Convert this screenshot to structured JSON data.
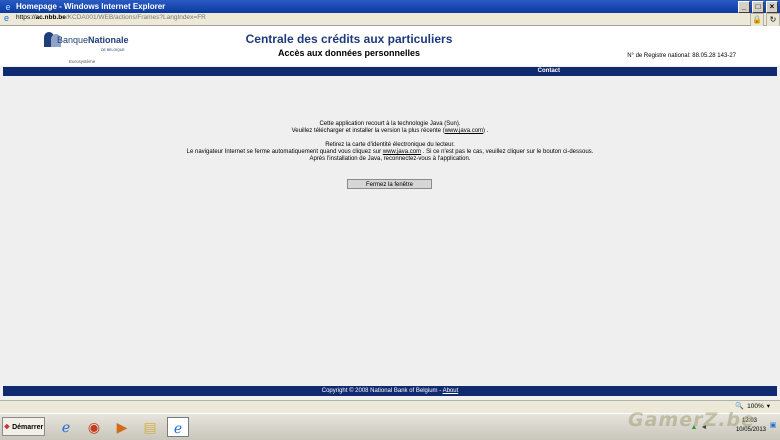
{
  "window": {
    "title": "Homepage - Windows Internet Explorer",
    "buttons": {
      "minimize": "_",
      "maximize": "□",
      "close": "×"
    }
  },
  "address": {
    "scheme": "https://",
    "host": "ac.nbb.be",
    "path": "/KCDA001/WEB/actions/Frames?LangIndex=FR",
    "icons": [
      "ie-page-icon",
      "lock-icon",
      "refresh-icon"
    ]
  },
  "header": {
    "logo_brand_light": "Banque",
    "logo_brand_bold": "Nationale",
    "logo_sub": "DE BELGIQUE",
    "logo_tagline": "Eurosystème",
    "title": "Centrale des crédits aux particuliers",
    "subtitle": "Accès aux données personnelles",
    "registry": "N° de Registre national: 88.05.28 143-27"
  },
  "nav": {
    "contact": "Contact"
  },
  "content": {
    "line1": "Cette application recourt à la technologie Java (Sun).",
    "line2_prefix": "Veuillez télécharger et installer la version la plus récente (",
    "line2_link": "www.java.com",
    "line2_suffix": ") .",
    "line3": "Retirez la carte d'identité électronique du lecteur.",
    "line4_prefix": "Le navigateur Internet se ferme automatiquement quand vous cliquez sur",
    "line4_link": "www.java.com",
    "line4_suffix": ". Si ce n'est pas le cas, veuillez cliquer sur le bouton ci-dessous.",
    "line5": "Après l'installation de Java, reconnectez-vous à l'application.",
    "close_button": "Fermez la fenêtre"
  },
  "footer": {
    "copyright": "Copyright © 2008 National Bank of Belgium  -",
    "about": "About"
  },
  "statusbar": {
    "zoom": "100%"
  },
  "taskbar": {
    "start": "Démarrer",
    "time": "12:03",
    "date": "10/05/2013"
  },
  "watermark": "GamerZ.be",
  "colors": {
    "navy": "#0f2a6e",
    "title_blue": "#1e3a7d"
  }
}
